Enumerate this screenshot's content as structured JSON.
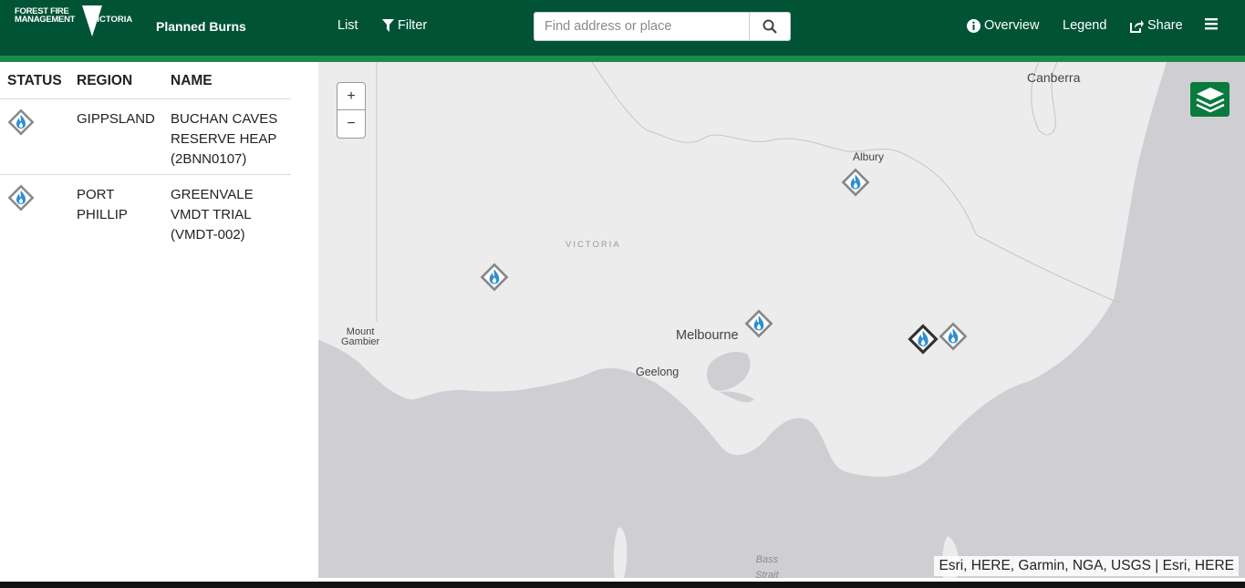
{
  "header": {
    "logo_line1": "FOREST FIRE",
    "logo_line2": "MANAGEMENT",
    "logo_victoria": "VICTORIA",
    "app_title": "Planned Burns",
    "nav_list": "List",
    "nav_filter": "Filter",
    "search_placeholder": "Find address or place",
    "nav_overview": "Overview",
    "nav_legend": "Legend",
    "nav_share": "Share",
    "icons": [
      "filter-icon",
      "search-icon",
      "info-icon",
      "share-icon",
      "hamburger-menu-icon"
    ]
  },
  "sidebar": {
    "columns": [
      "STATUS",
      "REGION",
      "NAME"
    ],
    "rows": [
      {
        "status_icon": "planned-burn-icon",
        "region_line1": "GIPPSLAND",
        "region_line2": "",
        "name_line1": "BUCHAN CAVES",
        "name_line2": "RESERVE HEAP",
        "name_line3": "(2BNN0107)"
      },
      {
        "status_icon": "planned-burn-icon",
        "region_line1": "PORT",
        "region_line2": "PHILLIP",
        "name_line1": "GREENVALE",
        "name_line2": "VMDT TRIAL",
        "name_line3": "(VMDT-002)"
      }
    ]
  },
  "map": {
    "zoom_in": "+",
    "zoom_out": "−",
    "labels": {
      "canberra": "Canberra",
      "albury": "Albury",
      "victoria": "VICTORIA",
      "mount_gambier_1": "Mount",
      "mount_gambier_2": "Gambier",
      "melbourne": "Melbourne",
      "geelong": "Geelong",
      "bass_1": "Bass",
      "bass_2": "Strait"
    },
    "attribution": "Esri, HERE, Garmin, NGA, USGS | Esri, HERE",
    "colors": {
      "land": "#ececec",
      "sea": "#cfcfd3",
      "brand": "#015336",
      "flame": "#2f8fd0"
    }
  }
}
